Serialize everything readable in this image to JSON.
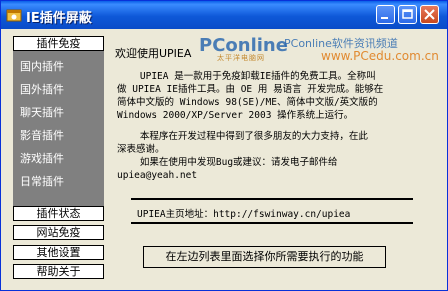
{
  "window": {
    "title": "IE插件屏蔽"
  },
  "sidebar": {
    "top_category": "插件免疫",
    "list_items": [
      "国内插件",
      "国外插件",
      "聊天插件",
      "影音插件",
      "游戏插件",
      "日常插件"
    ],
    "bottom_categories": [
      "插件状态",
      "网站免疫",
      "其他设置",
      "帮助关于"
    ]
  },
  "content": {
    "welcome": "欢迎使用UPIEA",
    "paragraph1": "    UPIEA 是一款用于免疫卸载IE插件的免费工具。全称叫\n做 UPIEA IE插件工具。由 OE 用 易语言 开发完成。能够在\n简体中文版的 Windows 98(SE)/ME、简体中文版/英文版的\nWindows 2000/XP/Server 2003 操作系统上运行。",
    "paragraph2": "    本程序在开发过程中得到了很多朋友的大力支持，在此\n深表感谢。\n    如果在使用中发现Bug或建议：请发电子邮件给\nupiea@yeah.net",
    "homepage": "UPIEA主页地址：http://fswinway.cn/upiea",
    "action_hint": "在左边列表里面选择你所需要执行的功能"
  },
  "watermark": {
    "logo": "PConline",
    "logo_sub": "太平洋电脑网",
    "tagline": "PConline软件资讯频道",
    "url": "www.PCedu.com.cn"
  }
}
